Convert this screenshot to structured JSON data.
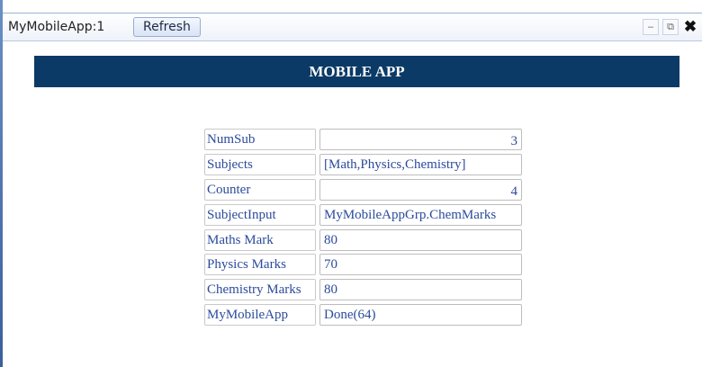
{
  "window": {
    "app_name": "MyMobileApp:1",
    "refresh_label": "Refresh",
    "controls": {
      "minimize": "–",
      "popout": "⧉",
      "close": "✖"
    }
  },
  "header": {
    "title": "MOBILE APP"
  },
  "fields": [
    {
      "label": "NumSub",
      "value": "3"
    },
    {
      "label": "Subjects",
      "value": "[Math,Physics,Chemistry]"
    },
    {
      "label": "Counter",
      "value": "4"
    },
    {
      "label": "SubjectInput",
      "value": "MyMobileAppGrp.ChemMarks"
    },
    {
      "label": "Maths Mark",
      "value": "80"
    },
    {
      "label": "Physics Marks",
      "value": "70"
    },
    {
      "label": "Chemistry Marks",
      "value": "80"
    },
    {
      "label": "MyMobileApp",
      "value": "Done(64)"
    }
  ],
  "colors": {
    "header_bg": "#0b3a66",
    "text_blue": "#2b4b9b"
  }
}
